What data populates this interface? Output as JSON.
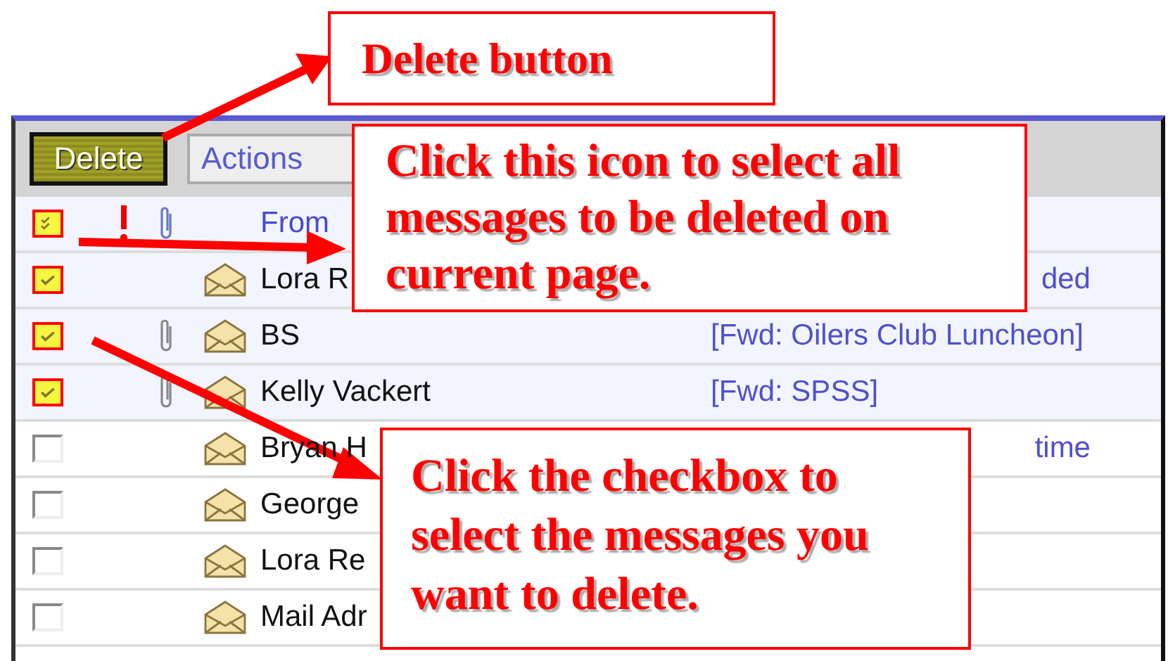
{
  "toolbar": {
    "delete_button": "Delete",
    "actions_dropdown": "Actions"
  },
  "header": {
    "all_checked": true,
    "from_label": "From"
  },
  "rows": [
    {
      "name": "Lora R",
      "checked": true,
      "attachment": false,
      "subject_tail": "ded"
    },
    {
      "name": "BS",
      "checked": true,
      "attachment": true,
      "subject": "[Fwd: Oilers Club Luncheon]"
    },
    {
      "name": "Kelly Vackert",
      "checked": true,
      "attachment": true,
      "subject": "[Fwd: SPSS]"
    },
    {
      "name": "Bryan H",
      "checked": false,
      "attachment": false,
      "subject_tail": "time"
    },
    {
      "name": "George",
      "checked": false,
      "attachment": false
    },
    {
      "name": "Lora Re",
      "checked": false,
      "attachment": false
    },
    {
      "name": "Mail Adr",
      "checked": false,
      "attachment": false
    }
  ],
  "callouts": [
    {
      "kind": "label",
      "text": "Delete button"
    },
    {
      "kind": "select-all",
      "text": "Click this icon to select all messages to be deleted on current page."
    },
    {
      "kind": "checkbox",
      "text": "Click the checkbox to select the messages you want to delete."
    }
  ]
}
